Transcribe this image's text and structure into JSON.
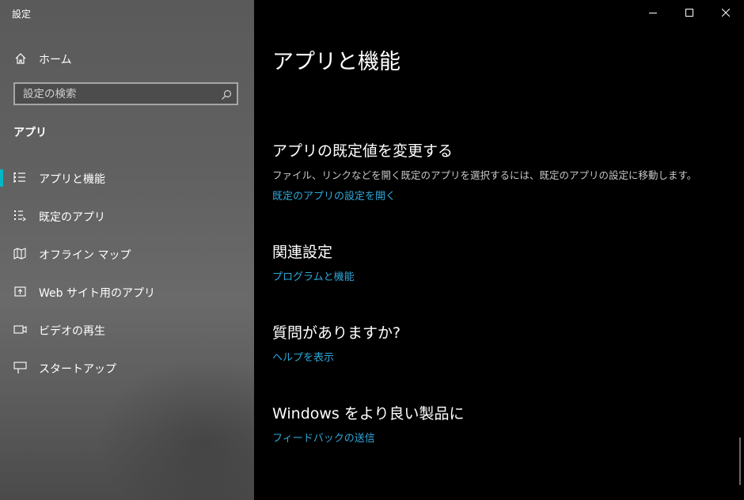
{
  "window": {
    "title": "設定",
    "controls": {
      "minimize": "minimize-icon",
      "maximize": "maximize-icon",
      "close": "close-icon"
    }
  },
  "sidebar": {
    "home_label": "ホーム",
    "search": {
      "placeholder": "設定の検索",
      "value": ""
    },
    "section_title": "アプリ",
    "items": [
      {
        "label": "アプリと機能",
        "icon": "apps-list-icon",
        "selected": true
      },
      {
        "label": "既定のアプリ",
        "icon": "default-apps-icon",
        "selected": false
      },
      {
        "label": "オフライン マップ",
        "icon": "map-icon",
        "selected": false
      },
      {
        "label": "Web サイト用のアプリ",
        "icon": "open-external-icon",
        "selected": false
      },
      {
        "label": "ビデオの再生",
        "icon": "video-icon",
        "selected": false
      },
      {
        "label": "スタートアップ",
        "icon": "startup-icon",
        "selected": false
      }
    ]
  },
  "main": {
    "page_title": "アプリと機能",
    "sections": [
      {
        "heading": "アプリの既定値を変更する",
        "description": "ファイル、リンクなどを開く既定のアプリを選択するには、既定のアプリの設定に移動します。",
        "link": "既定のアプリの設定を開く"
      },
      {
        "heading": "関連設定",
        "link": "プログラムと機能"
      },
      {
        "heading": "質問がありますか?",
        "link": "ヘルプを表示"
      },
      {
        "heading": "Windows をより良い製品に",
        "link": "フィードバックの送信"
      }
    ]
  },
  "colors": {
    "accent": "#00b7c3",
    "link": "#2ea8d9",
    "main_bg": "#000000"
  }
}
